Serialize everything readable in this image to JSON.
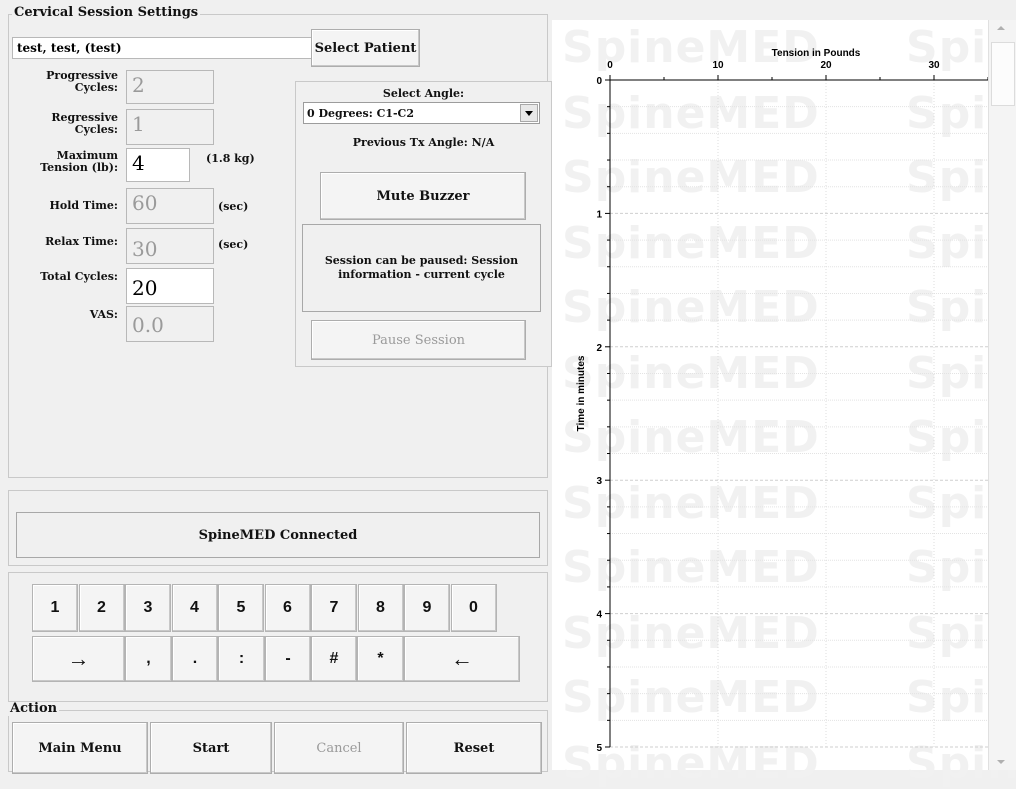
{
  "session": {
    "group_title": "Cervical Session Settings",
    "patient_name": "test, test, (test)",
    "select_patient_label": "Select Patient",
    "fields": {
      "progressive_label": "Progressive Cycles:",
      "progressive_value": "2",
      "regressive_label": "Regressive Cycles:",
      "regressive_value": "1",
      "max_tension_label": "Maximum Tension (lb):",
      "max_tension_value": "4",
      "max_tension_kg": "(1.8 kg)",
      "hold_label": "Hold Time:",
      "hold_value": "60",
      "hold_unit": "(sec)",
      "relax_label": "Relax Time:",
      "relax_value": "30",
      "relax_unit": "(sec)",
      "total_label": "Total Cycles:",
      "total_value": "20",
      "vas_label": "VAS:",
      "vas_value": "0.0"
    },
    "angle": {
      "title": "Select Angle:",
      "selected": "0 Degrees: C1-C2",
      "previous": "Previous Tx Angle: N/A"
    },
    "mute_buzzer_label": "Mute Buzzer",
    "info_text": "Session can be paused: Session information - current cycle",
    "pause_label": "Pause Session"
  },
  "status": {
    "text": "SpineMED Connected"
  },
  "keypad": {
    "row1": [
      "1",
      "2",
      "3",
      "4",
      "5",
      "6",
      "7",
      "8",
      "9",
      "0"
    ],
    "row2": [
      "→",
      ",",
      ".",
      ":",
      "-",
      "#",
      "*",
      "←"
    ]
  },
  "action": {
    "group_title": "Action",
    "main_menu": "Main Menu",
    "start": "Start",
    "cancel": "Cancel",
    "reset": "Reset"
  },
  "chart_data": {
    "type": "line",
    "title": "Tension in Pounds",
    "xlabel": "Tension in Pounds",
    "ylabel": "Time in minutes",
    "x_ticks": [
      0,
      10,
      20,
      30
    ],
    "y_ticks": [
      0,
      1,
      2,
      3,
      4,
      5
    ],
    "xlim": [
      0,
      35
    ],
    "ylim": [
      0,
      5
    ],
    "series": [],
    "grid": true,
    "watermark": "SpineMED"
  }
}
